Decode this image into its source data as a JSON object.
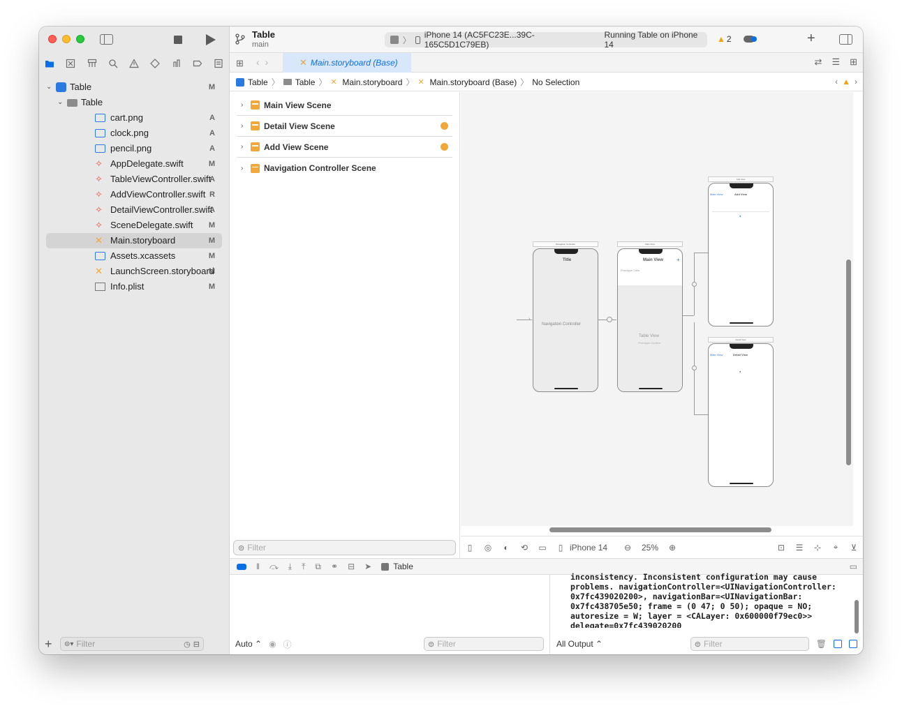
{
  "toolbar": {
    "project_name": "Table",
    "branch": "main",
    "scheme_target": "iPhone 14 (AC5FC23E...39C-165C5D1C79EB)",
    "run_status": "Running Table on iPhone 14",
    "warnings_count": "2"
  },
  "tab": {
    "active_label": "Main.storyboard (Base)"
  },
  "jumpbar": {
    "crumbs": [
      "Table",
      "Table",
      "Main.storyboard",
      "Main.storyboard (Base)",
      "No Selection"
    ]
  },
  "navigator": {
    "items": [
      {
        "label": "Table",
        "status": "M",
        "kind": "project",
        "level": 0
      },
      {
        "label": "Table",
        "status": "",
        "kind": "folder",
        "level": 1
      },
      {
        "label": "cart.png",
        "status": "A",
        "kind": "image",
        "level": 2
      },
      {
        "label": "clock.png",
        "status": "A",
        "kind": "image",
        "level": 2
      },
      {
        "label": "pencil.png",
        "status": "A",
        "kind": "image",
        "level": 2
      },
      {
        "label": "AppDelegate.swift",
        "status": "M",
        "kind": "swift",
        "level": 2
      },
      {
        "label": "TableViewController.swift",
        "status": "A",
        "kind": "swift",
        "level": 2
      },
      {
        "label": "AddViewController.swift",
        "status": "R",
        "kind": "swift",
        "level": 2
      },
      {
        "label": "DetailViewController.swift",
        "status": "A",
        "kind": "swift",
        "level": 2
      },
      {
        "label": "SceneDelegate.swift",
        "status": "M",
        "kind": "swift",
        "level": 2
      },
      {
        "label": "Main.storyboard",
        "status": "M",
        "kind": "storyboard",
        "level": 2
      },
      {
        "label": "Assets.xcassets",
        "status": "M",
        "kind": "assets",
        "level": 2
      },
      {
        "label": "LaunchScreen.storyboard",
        "status": "M",
        "kind": "storyboard",
        "level": 2
      },
      {
        "label": "Info.plist",
        "status": "M",
        "kind": "plist",
        "level": 2
      }
    ],
    "filter_placeholder": "Filter"
  },
  "outline": {
    "scenes": [
      "Main View Scene",
      "Detail View Scene",
      "Add View  Scene",
      "Navigation Controller Scene"
    ],
    "filter_placeholder": "Filter"
  },
  "canvas": {
    "nav_controller_label": "Navigation Controller",
    "nav_title": "Title",
    "main_view_title": "Main View",
    "table_view_label": "Table View",
    "prototype_label": "Prototype Content",
    "prototype_cells": "Prototype Cells",
    "add_view_title": "Add View",
    "detail_view_title": "Detail View",
    "back_label": "Main View",
    "nav_controller_scene_title": "Navigation Controller",
    "main_scene_title": "Main View",
    "add_scene_title": "Add View",
    "detail_scene_title": "Detail View"
  },
  "canvas_bar": {
    "device": "iPhone 14",
    "zoom": "25%"
  },
  "debug": {
    "target": "Table",
    "auto_label": "Auto ⌃",
    "left_filter_placeholder": "Filter",
    "output_label": "All Output ⌃",
    "right_filter_placeholder": "Filter",
    "console_lines": [
      "inconsistency. Inconsistent configuration may cause",
      "problems. navigationController=<UINavigationController:",
      "0x7fc439020200>, navigationBar=<UINavigationBar:",
      "0x7fc438705e50; frame = (0 47; 0 50); opaque = NO;",
      "autoresize = W; layer = <CALayer: 0x600000f79ec0>>",
      "delegate=0x7fc439020200"
    ]
  },
  "colors": {
    "accent": "#0a6ee6",
    "storyboard_orange": "#f0a83a",
    "swift_red": "#f05138"
  }
}
